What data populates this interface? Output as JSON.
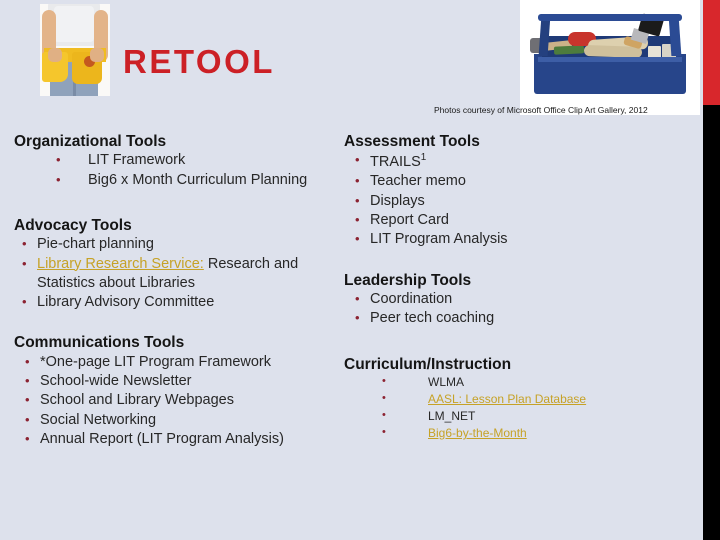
{
  "header": {
    "title": "RETOOL",
    "title_color": "#cc2026",
    "photo_credit": "Photos courtesy of Microsoft Office Clip Art Gallery, 2012",
    "belt_photo_alt": "tool-belt-photo",
    "toolbox_photo_alt": "blue-toolbox-photo",
    "accent_red": "#d8272c",
    "accent_black": "#000000"
  },
  "left_column": {
    "organizational": {
      "heading": "Organizational Tools",
      "items": [
        "LIT Framework",
        "Big6 x Month Curriculum Planning"
      ]
    },
    "advocacy": {
      "heading": "Advocacy Tools",
      "items": [
        {
          "text": "Pie-chart planning"
        },
        {
          "link": "Library Research Service:",
          "text": " Research and Statistics about Libraries"
        },
        {
          "text": "Library Advisory Committee"
        }
      ]
    },
    "communications": {
      "heading": "Communications Tools",
      "items": [
        "*One-page LIT Program Framework",
        "School-wide Newsletter",
        "School and Library Webpages",
        "Social Networking",
        "Annual Report (LIT Program Analysis)"
      ]
    }
  },
  "right_column": {
    "assessment": {
      "heading": "Assessment Tools",
      "items": [
        {
          "text": "TRAILS",
          "sup": "1"
        },
        {
          "text": "Teacher memo"
        },
        {
          "text": "Displays"
        },
        {
          "text": "Report Card"
        },
        {
          "text": "LIT Program Analysis"
        }
      ]
    },
    "leadership": {
      "heading": "Leadership Tools",
      "items": [
        "Coordination",
        "Peer tech coaching"
      ]
    },
    "curriculum": {
      "heading": "Curriculum/Instruction",
      "items": [
        {
          "text": "WLMA",
          "is_link": false
        },
        {
          "text": "AASL: Lesson Plan Database",
          "is_link": true
        },
        {
          "text": "LM_NET",
          "is_link": false
        },
        {
          "text": "Big6-by-the-Month",
          "is_link": true
        }
      ]
    }
  },
  "colors": {
    "background": "#dde1ec",
    "bullet": "#8c2332",
    "link": "#c6a227",
    "body_text": "#272727"
  }
}
